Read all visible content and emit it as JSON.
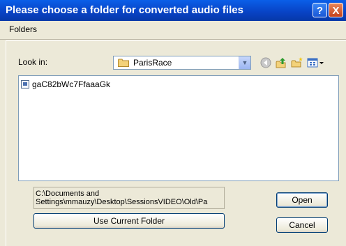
{
  "window": {
    "title": "Please choose a folder for converted audio files",
    "help_label": "?",
    "close_label": "X"
  },
  "menu": {
    "folders_label": "Folders"
  },
  "lookin": {
    "label": "Look in:",
    "value": "ParisRace",
    "icon": "folder-icon"
  },
  "toolbar": {
    "icons": [
      "back-icon",
      "up-folder-icon",
      "new-folder-icon",
      "view-menu-icon"
    ]
  },
  "files": [
    {
      "name": "gaC82bWc7FfaaaGk",
      "icon": "file-icon"
    }
  ],
  "path": {
    "line1": "C:\\Documents and",
    "line2": "Settings\\mmauzy\\Desktop\\SessionsVIDEO\\Old\\Pa"
  },
  "buttons": {
    "use_current": "Use Current Folder",
    "open": "Open",
    "cancel": "Cancel"
  },
  "colors": {
    "titlebar": "#0842c4",
    "dialog_bg": "#ece9d8",
    "list_bg": "#ffffff"
  }
}
